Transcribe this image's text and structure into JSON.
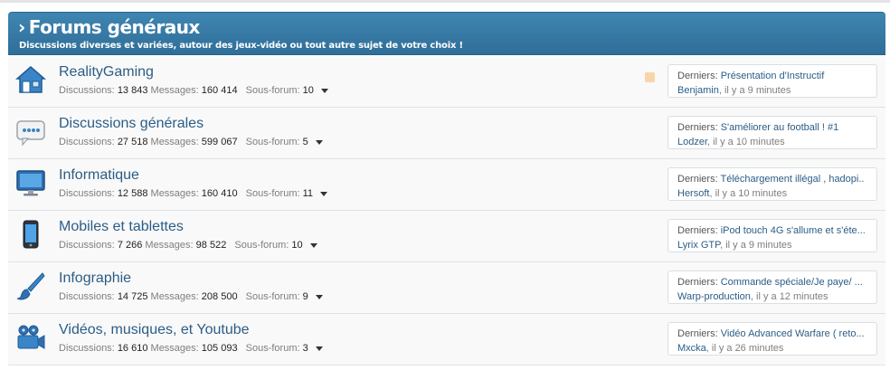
{
  "category": {
    "title": "Forums généraux",
    "description": "Discussions diverses et variées, autour des jeux-vidéo ou tout autre sujet de votre choix !"
  },
  "labels": {
    "discussions": "Discussions:",
    "messages": "Messages:",
    "subforum": "Sous-forum:",
    "latest": "Derniers:"
  },
  "forums": [
    {
      "icon": "house-icon",
      "name": "RealityGaming",
      "discussions": "13 843",
      "messages": "160 414",
      "subforums": "10",
      "latest_thread": "Présentation d'Instructif",
      "latest_user": "Benjamin",
      "latest_time": ", il y a 9 minutes"
    },
    {
      "icon": "chat-bubble-icon",
      "name": "Discussions générales",
      "discussions": "27 518",
      "messages": "599 067",
      "subforums": "5",
      "latest_thread": "S'améliorer au football ! #1",
      "latest_user": "Lodzer",
      "latest_time": ", il y a 10 minutes"
    },
    {
      "icon": "monitor-icon",
      "name": "Informatique",
      "discussions": "12 588",
      "messages": "160 410",
      "subforums": "11",
      "latest_thread": "Téléchargement illégal , hadopi..",
      "latest_user": "Hersoft",
      "latest_time": ", il y a 10 minutes"
    },
    {
      "icon": "smartphone-icon",
      "name": "Mobiles et tablettes",
      "discussions": "7 266",
      "messages": "98 522",
      "subforums": "10",
      "latest_thread": "iPod touch 4G s'allume et s'éte...",
      "latest_user": "Lyrix GTP",
      "latest_time": ", il y a 9 minutes"
    },
    {
      "icon": "paintbrush-icon",
      "name": "Infographie",
      "discussions": "14 725",
      "messages": "208 500",
      "subforums": "9",
      "latest_thread": "Commande spéciale/Je paye/ ...",
      "latest_user": "Warp-production",
      "latest_time": ", il y a 12 minutes"
    },
    {
      "icon": "video-camera-icon",
      "name": "Vidéos, musiques, et Youtube",
      "discussions": "16 610",
      "messages": "105 093",
      "subforums": "3",
      "latest_thread": "Vidéo Advanced Warfare ( reto...",
      "latest_user": "Mxcka",
      "latest_time": ", il y a 26 minutes"
    }
  ],
  "colors": {
    "header": "#3a7eab",
    "link": "#2b5d86",
    "muted": "#7e7e7e"
  }
}
